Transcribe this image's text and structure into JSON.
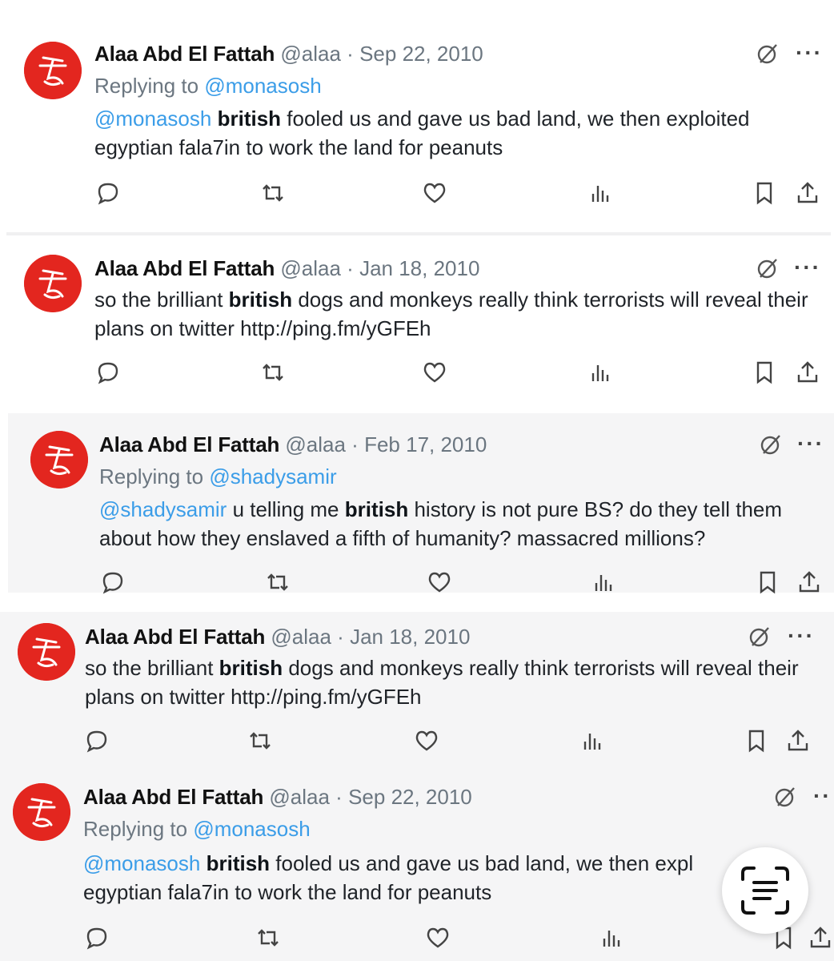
{
  "tweets": [
    {
      "name": "Alaa Abd El Fattah",
      "handle": "@alaa",
      "sep": "·",
      "date": "Sep 22, 2010",
      "replying_prefix": "Replying to",
      "replying_to": "@monasosh",
      "text_mention": "@monasosh",
      "text_bold": "british",
      "text_rest": "fooled us and gave us bad land, we then exploited egyptian fala7in to work the land for peanuts",
      "more": "···"
    },
    {
      "name": "Alaa Abd El Fattah",
      "handle": "@alaa",
      "sep": "·",
      "date": "Jan 18, 2010",
      "text_pre": "so the brilliant",
      "text_bold": "british",
      "text_rest": "dogs and monkeys really think terrorists will reveal their plans on twitter http://ping.fm/yGFEh",
      "more": "···"
    },
    {
      "name": "Alaa Abd El Fattah",
      "handle": "@alaa",
      "sep": "·",
      "date": "Feb 17, 2010",
      "replying_prefix": "Replying to",
      "replying_to": "@shadysamir",
      "text_mention": "@shadysamir",
      "text_pre": "u telling me",
      "text_bold": "british",
      "text_rest": "history is not pure BS? do they tell them about how they enslaved a fifth of humanity? massacred millions?",
      "more": "···"
    },
    {
      "name": "Alaa Abd El Fattah",
      "handle": "@alaa",
      "sep": "·",
      "date": "Jan 18, 2010",
      "text_pre": "so the brilliant",
      "text_bold": "british",
      "text_rest": "dogs and monkeys really think terrorists will reveal their plans on twitter http://ping.fm/yGFEh",
      "more": "···"
    },
    {
      "name": "Alaa Abd El Fattah",
      "handle": "@alaa",
      "sep": "·",
      "date": "Sep 22, 2010",
      "replying_prefix": "Replying to",
      "replying_to": "@monasosh",
      "text_mention": "@monasosh",
      "text_bold": "british",
      "text_rest": "fooled us and gave us bad land, we then expl",
      "text_rest_2": "egyptian fala7in to work the land for peanuts",
      "more": "··"
    }
  ],
  "colors": {
    "avatar": "#e3261f",
    "mention": "#3b9de8",
    "muted": "#6b7680",
    "card_gray": "#f5f5f6"
  },
  "icons": [
    "reply-icon",
    "retweet-icon",
    "like-icon",
    "views-icon",
    "bookmark-icon",
    "share-icon",
    "grok-icon",
    "text-scan-icon"
  ]
}
